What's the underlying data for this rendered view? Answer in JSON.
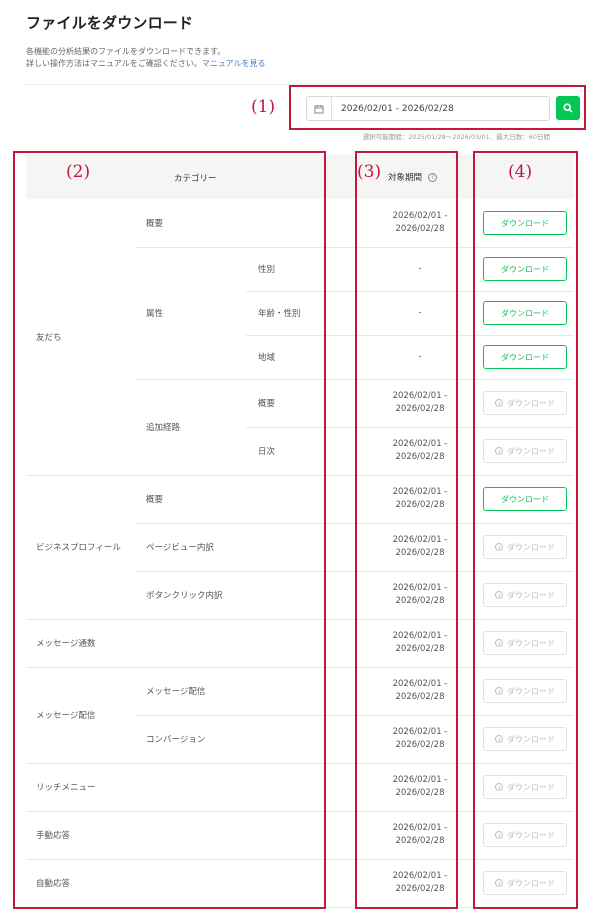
{
  "header": {
    "title": "ファイルをダウンロード",
    "description_line1": "各機能の分析結果のファイルをダウンロードできます。",
    "description_line2": "詳しい操作方法はマニュアルをご確認ください。",
    "manual_link": "マニュアルを見る"
  },
  "date_range": {
    "value": "2026/02/01 - 2026/02/28",
    "note": "選択可能期間：2025/01/28〜2026/03/01、最大日数：60日間",
    "calendar_icon": "calendar-icon",
    "search_icon": "search-icon"
  },
  "annotations": [
    "(1)",
    "(2)",
    "(3)",
    "(4)"
  ],
  "table": {
    "col_category": "カテゴリー",
    "col_period": "対象期間",
    "help_mark": "?",
    "download_label": "ダウンロード",
    "rows": [
      {
        "l1": "友だち",
        "l2": "概要",
        "l3": "",
        "period1": "2026/02/01 -",
        "period2": "2026/02/28",
        "enabled": true
      },
      {
        "l1": "",
        "l2": "属性",
        "l3": "性別",
        "period1": "-",
        "period2": "",
        "enabled": true
      },
      {
        "l1": "",
        "l2": "",
        "l3": "年齢・性別",
        "period1": "-",
        "period2": "",
        "enabled": true
      },
      {
        "l1": "",
        "l2": "",
        "l3": "地域",
        "period1": "-",
        "period2": "",
        "enabled": true
      },
      {
        "l1": "",
        "l2": "追加経路",
        "l3": "概要",
        "period1": "2026/02/01 -",
        "period2": "2026/02/28",
        "enabled": false
      },
      {
        "l1": "",
        "l2": "",
        "l3": "日次",
        "period1": "2026/02/01 -",
        "period2": "2026/02/28",
        "enabled": false
      },
      {
        "l1": "ビジネスプロフィール",
        "l2": "概要",
        "l3": "",
        "period1": "2026/02/01 -",
        "period2": "2026/02/28",
        "enabled": true
      },
      {
        "l1": "",
        "l2": "ページビュー内訳",
        "l3": "",
        "period1": "2026/02/01 -",
        "period2": "2026/02/28",
        "enabled": false
      },
      {
        "l1": "",
        "l2": "ボタンクリック内訳",
        "l3": "",
        "period1": "2026/02/01 -",
        "period2": "2026/02/28",
        "enabled": false
      },
      {
        "l1": "メッセージ通数",
        "l2": "",
        "l3": "",
        "period1": "2026/02/01 -",
        "period2": "2026/02/28",
        "enabled": false
      },
      {
        "l1": "メッセージ配信",
        "l2": "メッセージ配信",
        "l3": "",
        "period1": "2026/02/01 -",
        "period2": "2026/02/28",
        "enabled": false
      },
      {
        "l1": "",
        "l2": "コンバージョン",
        "l3": "",
        "period1": "2026/02/01 -",
        "period2": "2026/02/28",
        "enabled": false
      },
      {
        "l1": "リッチメニュー",
        "l2": "",
        "l3": "",
        "period1": "2026/02/01 -",
        "period2": "2026/02/28",
        "enabled": false
      },
      {
        "l1": "手動応答",
        "l2": "",
        "l3": "",
        "period1": "2026/02/01 -",
        "period2": "2026/02/28",
        "enabled": false
      },
      {
        "l1": "自動応答",
        "l2": "",
        "l3": "",
        "period1": "2026/02/01 -",
        "period2": "2026/02/28",
        "enabled": false
      }
    ]
  }
}
